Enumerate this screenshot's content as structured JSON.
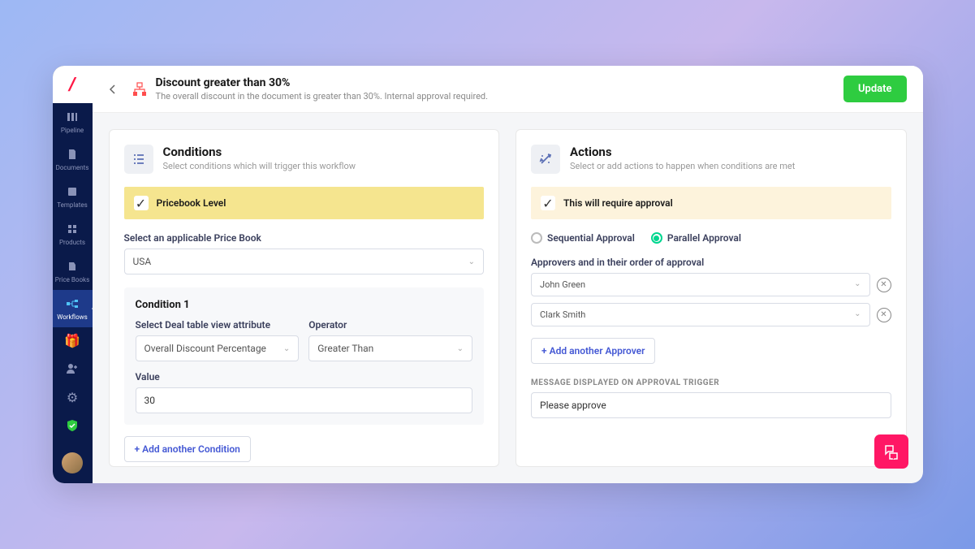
{
  "sidebar": {
    "items": [
      {
        "label": "Pipeline"
      },
      {
        "label": "Documents"
      },
      {
        "label": "Templates"
      },
      {
        "label": "Products"
      },
      {
        "label": "Price Books"
      },
      {
        "label": "Workflows"
      }
    ]
  },
  "header": {
    "title": "Discount greater than 30%",
    "subtitle": "The overall discount in the document is greater than 30%. Internal approval required.",
    "update_label": "Update"
  },
  "conditions": {
    "title": "Conditions",
    "subtitle": "Select conditions which will trigger this workflow",
    "banner": "Pricebook Level",
    "pricebook_label": "Select an applicable Price Book",
    "pricebook_value": "USA",
    "condition1": {
      "title": "Condition 1",
      "attr_label": "Select Deal table view attribute",
      "attr_value": "Overall Discount Percentage",
      "op_label": "Operator",
      "op_value": "Greater Than",
      "value_label": "Value",
      "value": "30"
    },
    "add_label": "+ Add another Condition"
  },
  "actions": {
    "title": "Actions",
    "subtitle": "Select or add actions to happen when conditions are met",
    "banner": "This will require approval",
    "radio_seq": "Sequential Approval",
    "radio_par": "Parallel Approval",
    "approvers_label": "Approvers and in their order of approval",
    "approvers": [
      "John Green",
      "Clark Smith"
    ],
    "add_label": "+ Add another Approver",
    "msg_label": "MESSAGE DISPLAYED ON APPROVAL TRIGGER",
    "msg_value": "Please approve"
  }
}
